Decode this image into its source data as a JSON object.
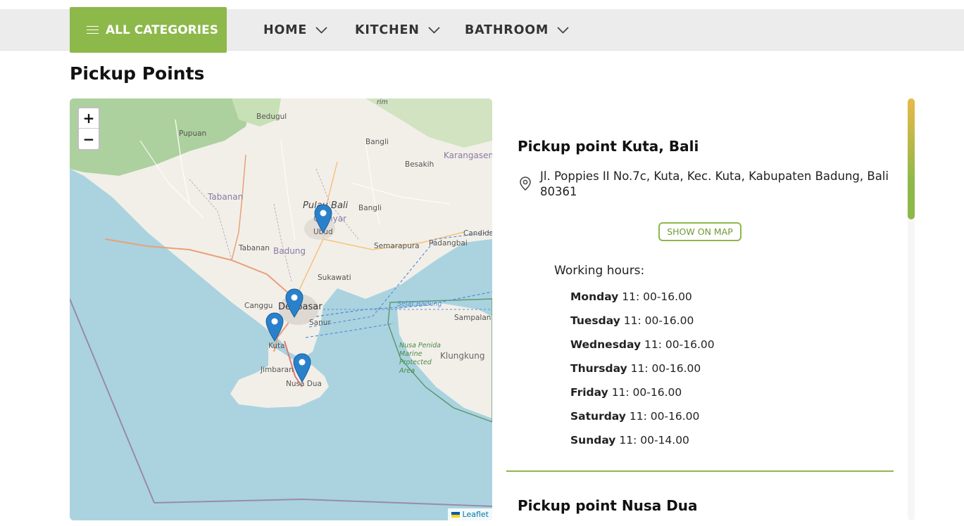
{
  "nav": {
    "all_categories": "ALL CATEGORIES",
    "items": [
      {
        "label": "HOME"
      },
      {
        "label": "KITCHEN"
      },
      {
        "label": "BATHROOM"
      }
    ]
  },
  "page": {
    "title": "Pickup Points"
  },
  "map": {
    "zoom_in": "+",
    "zoom_out": "−",
    "attribution": "Leaflet",
    "labels": {
      "bedugul": "Bedugul",
      "pupuan": "Pupuan",
      "bangli": "Bangli",
      "besakih": "Besakih",
      "karangasem": "Karangasem",
      "tabanan": "Tabanan",
      "pulau_bali": "Pulau Bali",
      "gianyar": "Gianyar",
      "bangli2": "Bangli",
      "ubud": "Ubud",
      "candidasa": "Candidas",
      "tabanan2": "Tabanan",
      "badung": "Badung",
      "semarapura": "Semarapura",
      "padangbai": "Padangbai",
      "sukawati": "Sukawati",
      "canggu": "Canggu",
      "denpasar": "Denpasar",
      "selat_badung": "Selat Badung",
      "sanur": "Sanur",
      "sampalan": "Sampalan",
      "kuta": "Kuta",
      "nusa_penida": "Nusa Penida Marine Protected Area",
      "klungkung": "Klungkung",
      "jimbaran": "Jimbaran",
      "nusa_dua": "Nusa Dua",
      "rim": "rim"
    }
  },
  "pickup_points": [
    {
      "name": "Pickup point Kuta, Bali",
      "address": "Jl. Poppies II No.7c, Kuta, Kec. Kuta, Kabupaten Badung, Bali 80361",
      "show_on_map": "SHOW ON MAP",
      "working_hours_label": "Working hours:",
      "hours": [
        {
          "day": "Monday",
          "time": "11: 00-16.00"
        },
        {
          "day": "Tuesday",
          "time": "11: 00-16.00"
        },
        {
          "day": "Wednesday",
          "time": "11: 00-16.00"
        },
        {
          "day": "Thursday",
          "time": "11: 00-16.00"
        },
        {
          "day": "Friday",
          "time": "11: 00-16.00"
        },
        {
          "day": "Saturday",
          "time": "11: 00-16.00"
        },
        {
          "day": "Sunday",
          "time": "11: 00-14.00"
        }
      ]
    },
    {
      "name": "Pickup point Nusa Dua"
    }
  ],
  "colors": {
    "accent": "#8db84a",
    "nav_bg": "#ececec",
    "marker": "#2a81cb",
    "sea": "#aad3df",
    "land": "#f2efe9"
  },
  "icons": {
    "menu": "hamburger-icon",
    "chevron": "chevron-down-icon",
    "location": "location-pin-icon",
    "marker": "map-marker-icon"
  }
}
